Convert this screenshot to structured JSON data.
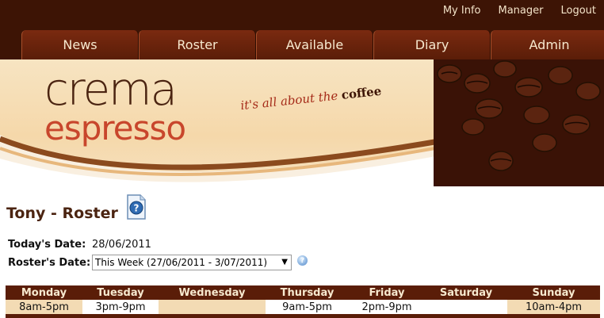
{
  "top_links": [
    "My Info",
    "Manager",
    "Logout"
  ],
  "nav": [
    "News",
    "Roster",
    "Available",
    "Diary",
    "Admin"
  ],
  "banner": {
    "logo_line1": "crema",
    "logo_line2": "espresso",
    "tagline_prefix": "it's all about the ",
    "tagline_word": "coffee"
  },
  "page_title": "Tony - Roster",
  "today_label": "Today's Date:",
  "today_value": "28/06/2011",
  "roster_label": "Roster's Date:",
  "roster_select_value": "This Week (27/06/2011 - 3/07/2011)",
  "roster": {
    "days": [
      "Monday",
      "Tuesday",
      "Wednesday",
      "Thursday",
      "Friday",
      "Saturday",
      "Sunday"
    ],
    "shifts": [
      "8am-5pm",
      "3pm-9pm",
      "",
      "9am-5pm",
      "2pm-9pm",
      "",
      "10am-4pm"
    ]
  },
  "colors": {
    "brown": "#3d1405",
    "tab": "#7a2a10",
    "tan": "#f3dbb4",
    "accent": "#c8462c"
  }
}
